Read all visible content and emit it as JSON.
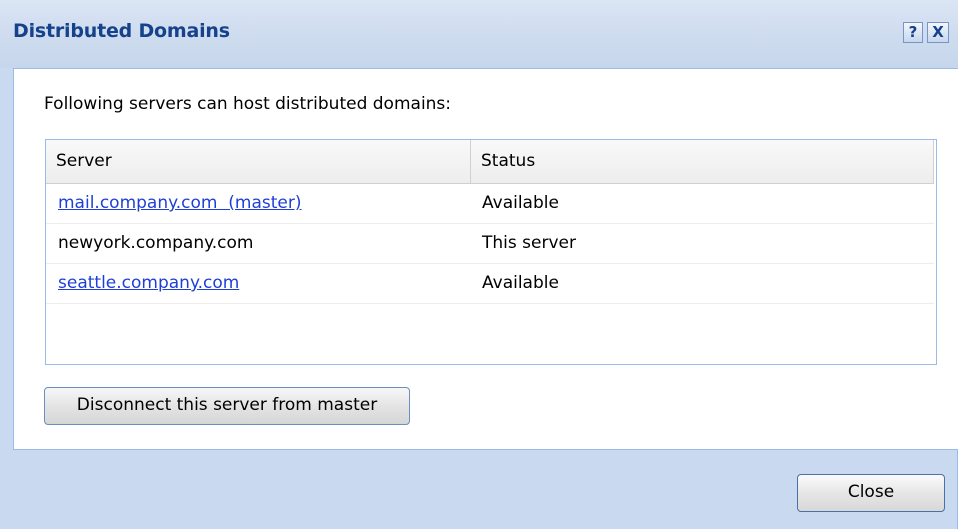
{
  "dialog": {
    "title": "Distributed Domains",
    "help_glyph": "?",
    "close_glyph": "X"
  },
  "intro_text": "Following servers can host distributed domains:",
  "grid": {
    "columns": {
      "server": "Server",
      "status": "Status"
    },
    "rows": [
      {
        "server": "mail.company.com  (master)",
        "status": "Available",
        "is_link": true
      },
      {
        "server": "newyork.company.com",
        "status": "This server",
        "is_link": false
      },
      {
        "server": "seattle.company.com",
        "status": "Available",
        "is_link": true
      }
    ]
  },
  "buttons": {
    "disconnect": "Disconnect this server from master",
    "close": "Close"
  },
  "colors": {
    "title": "#15428b",
    "link": "#1e3fd6",
    "frame": "#c9d9ef",
    "border": "#99bbe8"
  }
}
